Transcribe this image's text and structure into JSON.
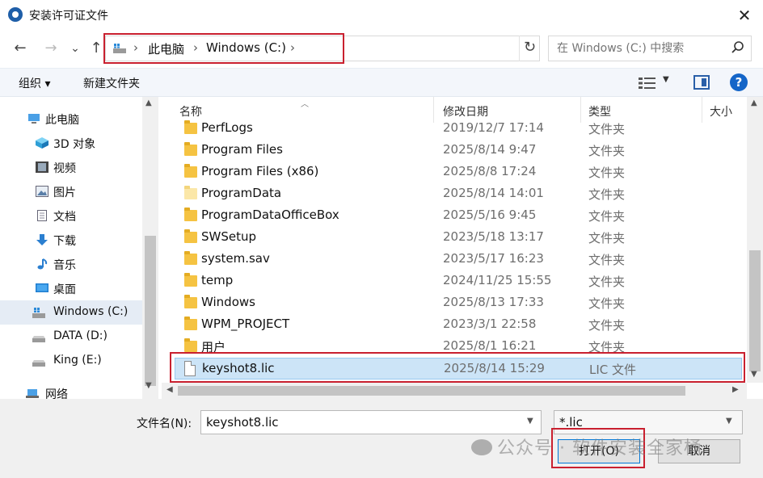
{
  "window": {
    "title": "安装许可证文件",
    "close_glyph": "✕"
  },
  "nav": {
    "back": "←",
    "forward": "→",
    "recent": "⌄",
    "up": "↑",
    "refresh": "↻",
    "dropdown": "⌄"
  },
  "address": {
    "crumbs": [
      "此电脑",
      "Windows (C:)"
    ],
    "sep": "›"
  },
  "search": {
    "placeholder": "在 Windows (C:) 中搜索"
  },
  "toolbar": {
    "organize": "组织 ▾",
    "new_folder": "新建文件夹",
    "view_dd": "▼",
    "help": "?"
  },
  "sidebar": {
    "items": [
      {
        "label": "此电脑",
        "icon": "computer-icon"
      },
      {
        "label": "3D 对象",
        "icon": "cube-icon"
      },
      {
        "label": "视频",
        "icon": "film-icon"
      },
      {
        "label": "图片",
        "icon": "picture-icon"
      },
      {
        "label": "文档",
        "icon": "document-icon"
      },
      {
        "label": "下载",
        "icon": "download-icon"
      },
      {
        "label": "音乐",
        "icon": "music-icon"
      },
      {
        "label": "桌面",
        "icon": "desktop-icon"
      },
      {
        "label": "Windows (C:)",
        "icon": "drive-icon",
        "selected": true
      },
      {
        "label": "DATA (D:)",
        "icon": "drive-icon"
      },
      {
        "label": "King (E:)",
        "icon": "drive-icon"
      },
      {
        "label": "网络",
        "icon": "network-icon"
      }
    ]
  },
  "columns": {
    "name": "名称",
    "date": "修改日期",
    "type": "类型",
    "size": "大小"
  },
  "files": [
    {
      "name": "PerfLogs",
      "date": "2019/12/7 17:14",
      "type": "文件夹",
      "kind": "folder"
    },
    {
      "name": "Program Files",
      "date": "2025/8/14 9:47",
      "type": "文件夹",
      "kind": "folder"
    },
    {
      "name": "Program Files (x86)",
      "date": "2025/8/8 17:24",
      "type": "文件夹",
      "kind": "folder"
    },
    {
      "name": "ProgramData",
      "date": "2025/8/14 14:01",
      "type": "文件夹",
      "kind": "folder-hidden"
    },
    {
      "name": "ProgramDataOfficeBox",
      "date": "2025/5/16 9:45",
      "type": "文件夹",
      "kind": "folder"
    },
    {
      "name": "SWSetup",
      "date": "2023/5/18 13:17",
      "type": "文件夹",
      "kind": "folder"
    },
    {
      "name": "system.sav",
      "date": "2023/5/17 16:23",
      "type": "文件夹",
      "kind": "folder"
    },
    {
      "name": "temp",
      "date": "2024/11/25 15:55",
      "type": "文件夹",
      "kind": "folder"
    },
    {
      "name": "Windows",
      "date": "2025/8/13 17:33",
      "type": "文件夹",
      "kind": "folder"
    },
    {
      "name": "WPM_PROJECT",
      "date": "2023/3/1 22:58",
      "type": "文件夹",
      "kind": "folder"
    },
    {
      "name": "用户",
      "date": "2025/8/1 16:21",
      "type": "文件夹",
      "kind": "folder"
    },
    {
      "name": "keyshot8.lic",
      "date": "2025/8/14 15:29",
      "type": "LIC 文件",
      "kind": "file",
      "selected": true
    }
  ],
  "footer": {
    "filename_label": "文件名(N):",
    "filename_value": "keyshot8.lic",
    "filter_value": "*.lic",
    "open_label": "打开(O)",
    "cancel_label": "取消",
    "watermark": "公众号 · 软件安装全家桶"
  },
  "colors": {
    "highlight": "#c9202f",
    "selection": "#cce4f7",
    "accent": "#0078d7"
  }
}
